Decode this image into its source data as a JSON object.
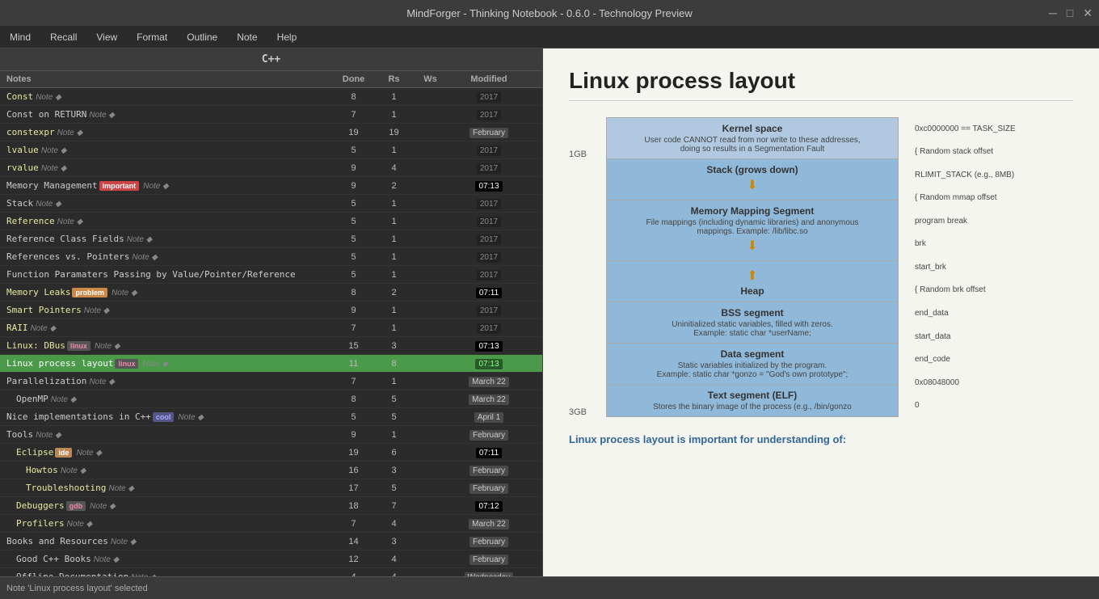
{
  "titlebar": {
    "title": "MindForger - Thinking Notebook - 0.6.0 - Technology Preview",
    "minimize": "─",
    "maximize": "□",
    "close": "✕"
  },
  "menubar": {
    "items": [
      "Mind",
      "Recall",
      "View",
      "Format",
      "Outline",
      "Note",
      "Help"
    ]
  },
  "notebook": {
    "title": "C++",
    "columns": [
      "Notes",
      "Done",
      "Rs",
      "Ws",
      "Modified",
      ""
    ]
  },
  "notes": [
    {
      "name": "Const",
      "type": "Note",
      "indent": 1,
      "done": "8",
      "rs": "1",
      "ws": "",
      "date": "2017",
      "dateType": "dark",
      "tags": [],
      "selected": false
    },
    {
      "name": "Const on RETURN",
      "type": "Note",
      "indent": 1,
      "done": "7",
      "rs": "1",
      "ws": "",
      "date": "2017",
      "dateType": "dark",
      "tags": [],
      "selected": false
    },
    {
      "name": "constexpr",
      "type": "Note",
      "indent": 1,
      "done": "19",
      "rs": "19",
      "ws": "",
      "date": "February",
      "dateType": "feb",
      "tags": [],
      "selected": false
    },
    {
      "name": "lvalue",
      "type": "Note",
      "indent": 1,
      "done": "5",
      "rs": "1",
      "ws": "",
      "date": "2017",
      "dateType": "dark",
      "tags": [],
      "selected": false
    },
    {
      "name": "rvalue",
      "type": "Note",
      "indent": 1,
      "done": "9",
      "rs": "4",
      "ws": "",
      "date": "2017",
      "dateType": "dark",
      "tags": [],
      "selected": false
    },
    {
      "name": "Memory Management",
      "type": "Note",
      "indent": 1,
      "done": "9",
      "rs": "2",
      "ws": "",
      "date": "07:13",
      "dateType": "time",
      "tags": [
        "important"
      ],
      "selected": false
    },
    {
      "name": "Stack",
      "type": "Note",
      "indent": 1,
      "done": "5",
      "rs": "1",
      "ws": "",
      "date": "2017",
      "dateType": "dark",
      "tags": [],
      "selected": false
    },
    {
      "name": "Reference",
      "type": "Note",
      "indent": 1,
      "done": "5",
      "rs": "1",
      "ws": "",
      "date": "2017",
      "dateType": "dark",
      "tags": [],
      "selected": false
    },
    {
      "name": "Reference Class Fields",
      "type": "Note",
      "indent": 1,
      "done": "5",
      "rs": "1",
      "ws": "",
      "date": "2017",
      "dateType": "dark",
      "tags": [],
      "selected": false
    },
    {
      "name": "References vs. Pointers",
      "type": "Note",
      "indent": 1,
      "done": "5",
      "rs": "1",
      "ws": "",
      "date": "2017",
      "dateType": "dark",
      "tags": [],
      "selected": false
    },
    {
      "name": "Function Paramaters Passing by Value/Pointer/Reference",
      "type": "",
      "indent": 1,
      "done": "5",
      "rs": "1",
      "ws": "",
      "date": "2017",
      "dateType": "dark",
      "tags": [],
      "selected": false
    },
    {
      "name": "Memory Leaks",
      "type": "Note",
      "indent": 1,
      "done": "8",
      "rs": "2",
      "ws": "",
      "date": "07:11",
      "dateType": "time",
      "tags": [
        "problem"
      ],
      "selected": false
    },
    {
      "name": "Smart Pointers",
      "type": "Note",
      "indent": 1,
      "done": "9",
      "rs": "1",
      "ws": "",
      "date": "2017",
      "dateType": "dark",
      "tags": [],
      "selected": false
    },
    {
      "name": "RAII",
      "type": "Note",
      "indent": 1,
      "done": "7",
      "rs": "1",
      "ws": "",
      "date": "2017",
      "dateType": "dark",
      "tags": [],
      "selected": false
    },
    {
      "name": "Linux: DBus",
      "type": "Note",
      "indent": 1,
      "done": "15",
      "rs": "3",
      "ws": "",
      "date": "07:13",
      "dateType": "time",
      "tags": [
        "linux"
      ],
      "selected": false
    },
    {
      "name": "Linux process layout",
      "type": "Note",
      "indent": 1,
      "done": "11",
      "rs": "8",
      "ws": "",
      "date": "07:13",
      "dateType": "green",
      "tags": [
        "linux"
      ],
      "selected": true
    },
    {
      "name": "Parallelization",
      "type": "Note",
      "indent": 1,
      "done": "7",
      "rs": "1",
      "ws": "",
      "date": "March 22",
      "dateType": "mar",
      "tags": [],
      "selected": false
    },
    {
      "name": "OpenMP",
      "type": "Note",
      "indent": 2,
      "done": "8",
      "rs": "5",
      "ws": "",
      "date": "March 22",
      "dateType": "mar",
      "tags": [],
      "selected": false
    },
    {
      "name": "Nice implementations in C++",
      "type": "Note",
      "indent": 1,
      "done": "5",
      "rs": "5",
      "ws": "",
      "date": "April 1",
      "dateType": "apr",
      "tags": [
        "cool"
      ],
      "selected": false
    },
    {
      "name": "Tools",
      "type": "Note",
      "indent": 1,
      "done": "9",
      "rs": "1",
      "ws": "",
      "date": "February",
      "dateType": "feb",
      "tags": [],
      "selected": false
    },
    {
      "name": "Eclipse",
      "type": "Note",
      "indent": 2,
      "done": "19",
      "rs": "6",
      "ws": "",
      "date": "07:11",
      "dateType": "time",
      "tags": [
        "ide"
      ],
      "selected": false
    },
    {
      "name": "Howtos",
      "type": "Note",
      "indent": 3,
      "done": "16",
      "rs": "3",
      "ws": "",
      "date": "February",
      "dateType": "feb",
      "tags": [],
      "selected": false
    },
    {
      "name": "Troubleshooting",
      "type": "Note",
      "indent": 3,
      "done": "17",
      "rs": "5",
      "ws": "",
      "date": "February",
      "dateType": "feb",
      "tags": [],
      "selected": false
    },
    {
      "name": "Debuggers",
      "type": "Note",
      "indent": 2,
      "done": "18",
      "rs": "7",
      "ws": "",
      "date": "07:12",
      "dateType": "time",
      "tags": [
        "gdb"
      ],
      "selected": false
    },
    {
      "name": "Profilers",
      "type": "Note",
      "indent": 2,
      "done": "7",
      "rs": "4",
      "ws": "",
      "date": "March 22",
      "dateType": "mar",
      "tags": [],
      "selected": false
    },
    {
      "name": "Books and Resources",
      "type": "Note",
      "indent": 1,
      "done": "14",
      "rs": "3",
      "ws": "",
      "date": "February",
      "dateType": "feb",
      "tags": [],
      "selected": false
    },
    {
      "name": "Good C++ Books",
      "type": "Note",
      "indent": 2,
      "done": "12",
      "rs": "4",
      "ws": "",
      "date": "February",
      "dateType": "feb",
      "tags": [],
      "selected": false
    },
    {
      "name": "Offline Documentation",
      "type": "Note",
      "indent": 2,
      "done": "4",
      "rs": "4",
      "ws": "",
      "date": "Wednesday",
      "dateType": "wed",
      "tags": [],
      "selected": false
    }
  ],
  "content": {
    "title": "Linux process layout",
    "footer_text": "Linux process layout is important for understanding of:",
    "memory_blocks": [
      {
        "id": "kernel",
        "title": "Kernel space",
        "desc": "User code CANNOT read from nor write to these addresses,\ndoing so results in a Segmentation Fault",
        "class": "kernel",
        "arrow": null
      },
      {
        "id": "stack",
        "title": "Stack (grows down)",
        "desc": "",
        "class": "stack",
        "arrow": "down"
      },
      {
        "id": "mmap",
        "title": "Memory Mapping Segment",
        "desc": "File mappings (including dynamic libraries) and anonymous\nmappings. Example: /lib/libc.so",
        "class": "mmap",
        "arrow": "down"
      },
      {
        "id": "heap",
        "title": "Heap",
        "desc": "",
        "class": "heap",
        "arrow": "up"
      },
      {
        "id": "bss",
        "title": "BSS segment",
        "desc": "Uninitialized static variables, filled with zeros.\nExample: static char *userName;",
        "class": "bss",
        "arrow": null
      },
      {
        "id": "data",
        "title": "Data segment",
        "desc": "Static variables initialized by the program.\nExample: static char *gonzo = \"God's own prototype\";",
        "class": "data",
        "arrow": null
      },
      {
        "id": "text",
        "title": "Text segment (ELF)",
        "desc": "Stores the binary image of the process (e.g., /bin/gonzo",
        "class": "text",
        "arrow": null
      }
    ],
    "left_labels": [
      "1GB",
      "3GB"
    ],
    "right_annotations": [
      "0xc0000000 == TASK_SIZE",
      "{ Random stack offset",
      "RLIMIT_STACK (e.g., 8MB)",
      "{ Random mmap offset",
      "program break",
      "brk",
      "start_brk",
      "{ Random brk offset",
      "end_data",
      "start_data",
      "end_code",
      "0x08048000",
      "0"
    ]
  },
  "statusbar": {
    "text": "Note 'Linux process layout' selected"
  }
}
